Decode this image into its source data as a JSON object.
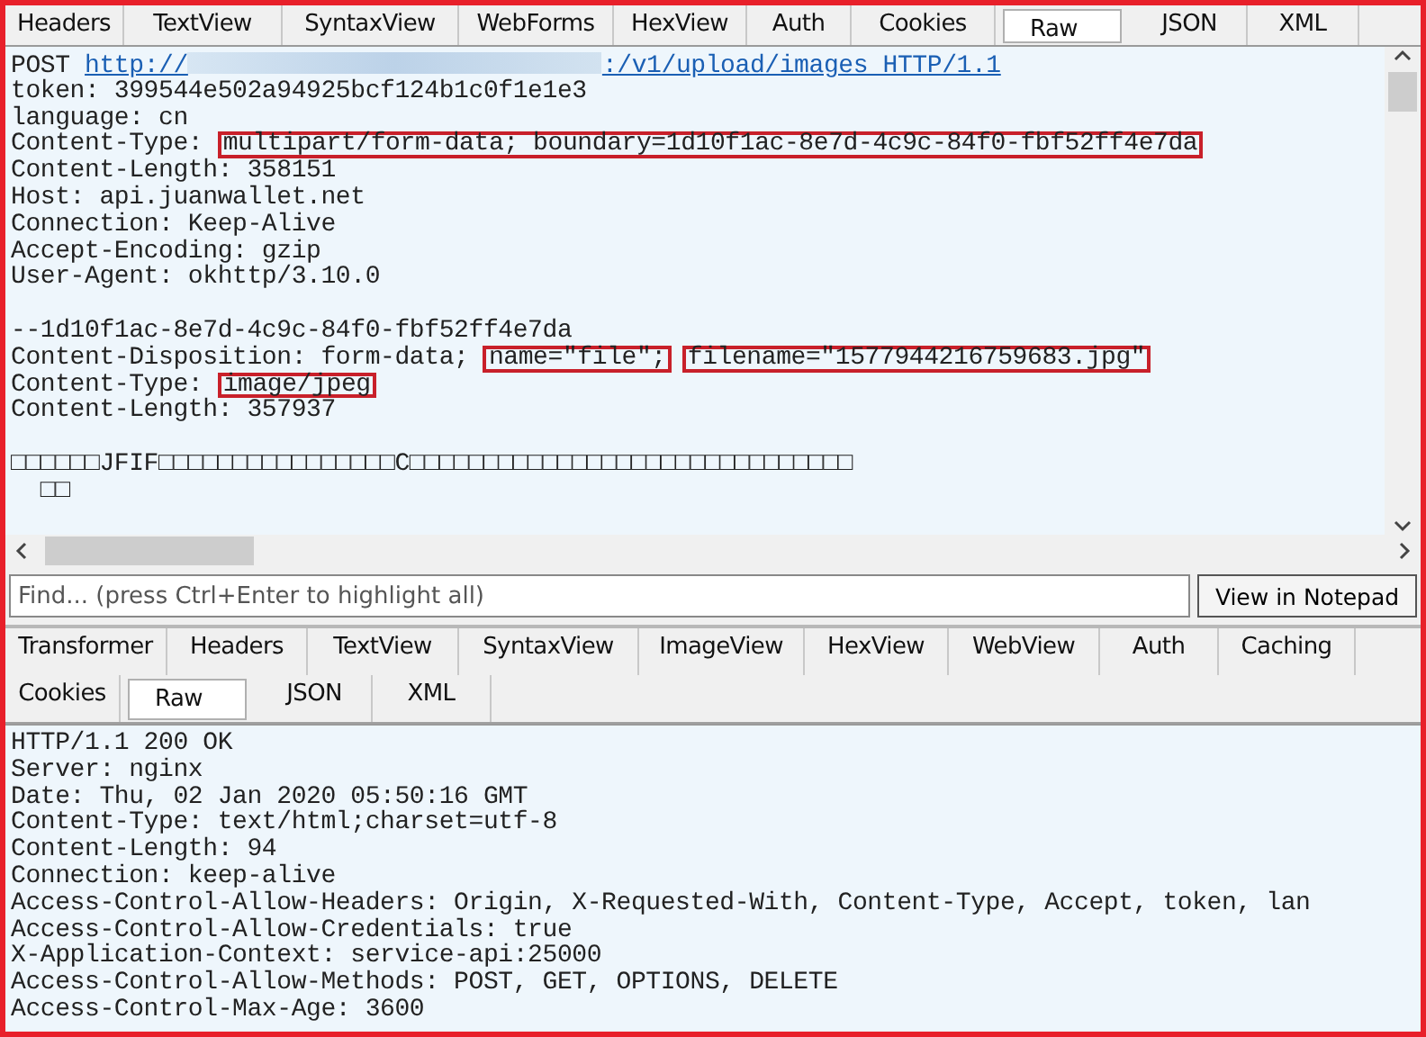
{
  "request_tabs": [
    {
      "label": "Headers",
      "selected": false
    },
    {
      "label": "TextView",
      "selected": false
    },
    {
      "label": "SyntaxView",
      "selected": false
    },
    {
      "label": "WebForms",
      "selected": false
    },
    {
      "label": "HexView",
      "selected": false
    },
    {
      "label": "Auth",
      "selected": false
    },
    {
      "label": "Cookies",
      "selected": false
    },
    {
      "label": "Raw",
      "selected": true
    },
    {
      "label": "JSON",
      "selected": false
    },
    {
      "label": "XML",
      "selected": false
    }
  ],
  "request_blocks": [
    [
      [
        {
          "kind": "plain",
          "text": "POST "
        },
        {
          "kind": "link",
          "text": "http://"
        },
        {
          "kind": "redacted"
        },
        {
          "kind": "link",
          "text": ":/v1/upload/images HTTP/1.1"
        }
      ],
      [
        {
          "kind": "plain",
          "text": "token: 399544e502a94925bcf124b1c0f1e1e3"
        }
      ],
      [
        {
          "kind": "plain",
          "text": "language: cn"
        }
      ],
      [
        {
          "kind": "plain",
          "text": "Content-Type: "
        },
        {
          "kind": "highlight",
          "text": "multipart/form-data; boundary=1d10f1ac-8e7d-4c9c-84f0-fbf52ff4e7da"
        }
      ],
      [
        {
          "kind": "plain",
          "text": "Content-Length: 358151"
        }
      ],
      [
        {
          "kind": "plain",
          "text": "Host: api.juanwallet.net"
        }
      ],
      [
        {
          "kind": "plain",
          "text": "Connection: Keep-Alive"
        }
      ],
      [
        {
          "kind": "plain",
          "text": "Accept-Encoding: gzip"
        }
      ],
      [
        {
          "kind": "plain",
          "text": "User-Agent: okhttp/3.10.0"
        }
      ]
    ],
    [
      [
        {
          "kind": "plain",
          "text": "--1d10f1ac-8e7d-4c9c-84f0-fbf52ff4e7da"
        }
      ],
      [
        {
          "kind": "plain",
          "text": "Content-Disposition: form-data; "
        },
        {
          "kind": "highlight",
          "text": "name=\"file\";"
        },
        {
          "kind": "highlight",
          "text": "filename=\"1577944216759683.jpg\""
        }
      ],
      [
        {
          "kind": "plain",
          "text": "Content-Type: "
        },
        {
          "kind": "highlight",
          "text": "image/jpeg"
        }
      ],
      [
        {
          "kind": "plain",
          "text": "Content-Length: 357937"
        }
      ]
    ],
    [
      [
        {
          "kind": "plain",
          "text": "□□□□□□JFIF□□□□□□□□□□□□□□□□C□□□□□□□□□□□□□□□□□□□□□□□□□□□□□□"
        }
      ],
      [
        {
          "kind": "plain",
          "text": "  □□"
        }
      ]
    ]
  ],
  "find": {
    "placeholder": "Find... (press Ctrl+Enter to highlight all)",
    "button": "View in Notepad"
  },
  "response_tabs": [
    [
      {
        "label": "Transformer",
        "selected": false
      },
      {
        "label": "Headers",
        "selected": false
      },
      {
        "label": "TextView",
        "selected": false
      },
      {
        "label": "SyntaxView",
        "selected": false
      },
      {
        "label": "ImageView",
        "selected": false
      },
      {
        "label": "HexView",
        "selected": false
      },
      {
        "label": "WebView",
        "selected": false
      },
      {
        "label": "Auth",
        "selected": false
      },
      {
        "label": "Caching",
        "selected": false
      }
    ],
    [
      {
        "label": "Cookies",
        "selected": false
      },
      {
        "label": "Raw",
        "selected": true
      },
      {
        "label": "JSON",
        "selected": false
      },
      {
        "label": "XML",
        "selected": false
      }
    ]
  ],
  "response_lines": [
    "HTTP/1.1 200 OK",
    "Server: nginx",
    "Date: Thu, 02 Jan 2020 05:50:16 GMT",
    "Content-Type: text/html;charset=utf-8",
    "Content-Length: 94",
    "Connection: keep-alive",
    "Access-Control-Allow-Headers: Origin, X-Requested-With, Content-Type, Accept, token, lan",
    "Access-Control-Allow-Credentials: true",
    "X-Application-Context: service-api:25000",
    "Access-Control-Allow-Methods: POST, GET, OPTIONS, DELETE",
    "Access-Control-Max-Age: 3600"
  ]
}
